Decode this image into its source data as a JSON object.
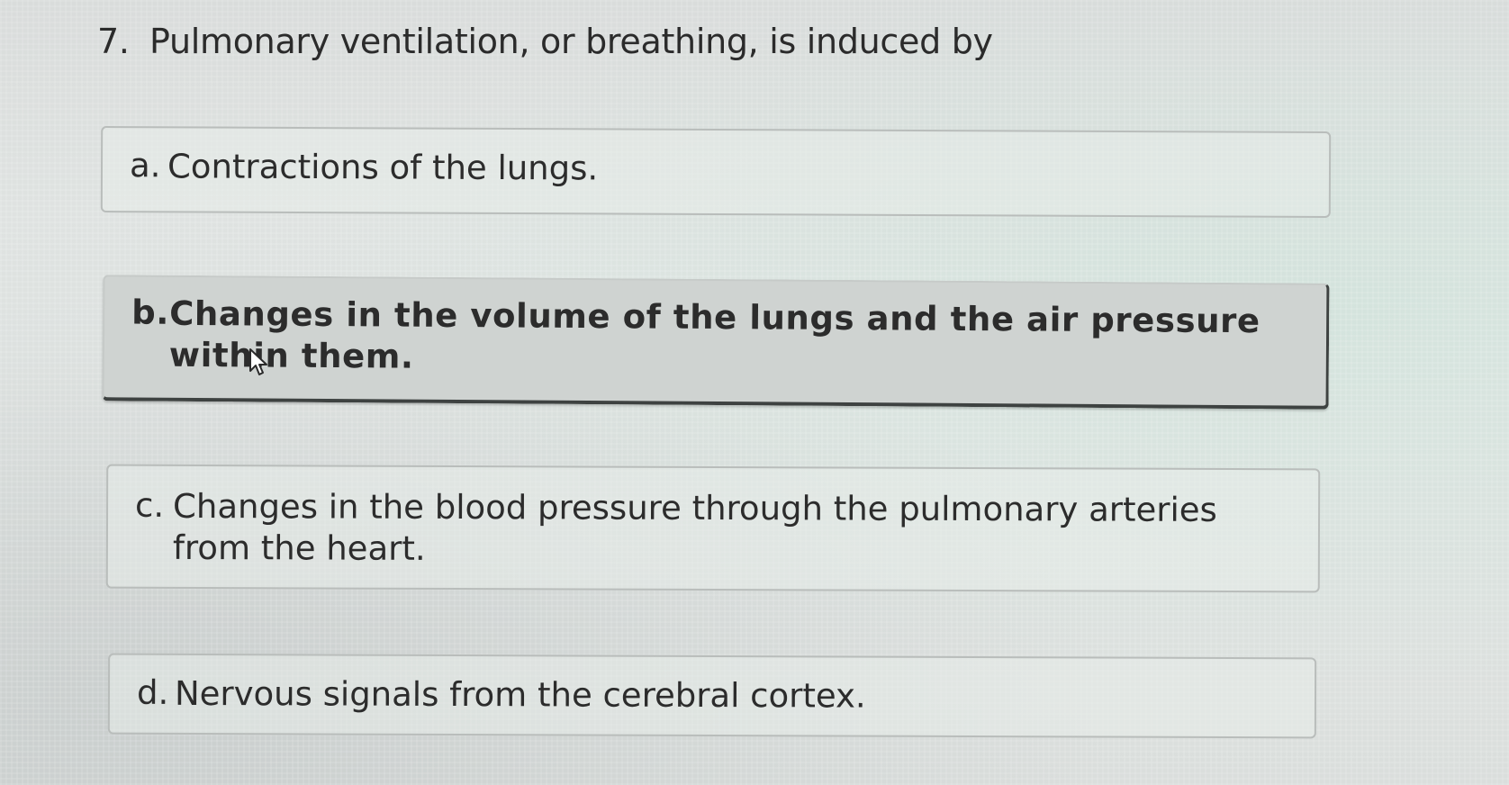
{
  "question": {
    "number": "7.",
    "text": "Pulmonary ventilation, or breathing, is induced by"
  },
  "options": [
    {
      "letter": "a.",
      "text": "Contractions of the lungs.",
      "selected": false
    },
    {
      "letter": "b.",
      "text": "Changes in the volume of the lungs and the air pressure within them.",
      "selected": true
    },
    {
      "letter": "c.",
      "text": "Changes in the blood pressure through the pulmonary arteries from the heart.",
      "selected": false
    },
    {
      "letter": "d.",
      "text": "Nervous signals from the cerebral cortex.",
      "selected": false
    }
  ],
  "colors": {
    "background": "#e0e4e2",
    "selected_option": "#cfd3d1",
    "border": "#b9bdbb",
    "text": "#2b2b2b"
  },
  "icons": {
    "cursor": "mouse-pointer-icon"
  }
}
